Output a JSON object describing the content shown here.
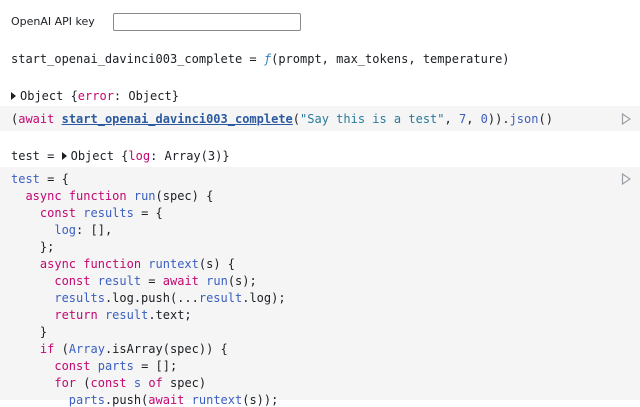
{
  "apikey": {
    "label": "OpenAI API key",
    "value": ""
  },
  "fn_line": {
    "name": "start_openai_davinci003_complete",
    "eq": " = ",
    "f": "ƒ",
    "params": "(prompt, max_tokens, temperature)"
  },
  "obj1": {
    "prefix": "Object {",
    "key": "error",
    "sep": ": ",
    "value": "Object",
    "suffix": "}"
  },
  "cell1": {
    "open": "(",
    "await": "await",
    "space": " ",
    "fn": "start_openai_davinci003_complete",
    "args_open": "(",
    "prompt": "\"Say this is a test\"",
    "comma1": ", ",
    "max_tokens": "7",
    "comma2": ", ",
    "temperature": "0",
    "args_close": ")).",
    "json": "json",
    "end": "()"
  },
  "test_line": {
    "name": "test",
    "eq": " = ",
    "prefix": "Object {",
    "key": "log",
    "sep": ": ",
    "value": "Array(3)",
    "suffix": "}"
  },
  "code": {
    "l1_a": "test",
    "l1_b": " = {",
    "l2_kw": "async function",
    "l2_name": "run",
    "l2_rest": "(spec) {",
    "l3_kw": "const",
    "l3_name": "results",
    "l3_rest": " = {",
    "l4_name": "log",
    "l4_rest": ": [],",
    "l5": "};",
    "l6_kw": "async function",
    "l6_name": "runtext",
    "l6_rest": "(s) {",
    "l7_kw": "const",
    "l7_name": "result",
    "l7_mid": " = ",
    "l7_kw2": "await",
    "l7_fn": "run",
    "l7_rest": "(s);",
    "l8_a": "results",
    "l8_b": ".log.push(...",
    "l8_c": "result",
    "l8_d": ".log);",
    "l9_kw": "return",
    "l9_a": "result",
    "l9_b": ".text;",
    "l10": "}",
    "l11_kw": "if",
    "l11_a": " (",
    "l11_b": "Array",
    "l11_c": ".isArray(spec)) {",
    "l12_kw": "const",
    "l12_name": "parts",
    "l12_rest": " = [];",
    "l13_kw": "for",
    "l13_a": " (",
    "l13_kw2": "const",
    "l13_b": " s ",
    "l13_kw3": "of",
    "l13_c": " spec)",
    "l14_a": "parts",
    "l14_b": ".push(",
    "l14_kw": "await",
    "l14_fn": "runtext",
    "l14_rest": "(s));"
  },
  "icons": {
    "run": "play-triangle-icon"
  }
}
